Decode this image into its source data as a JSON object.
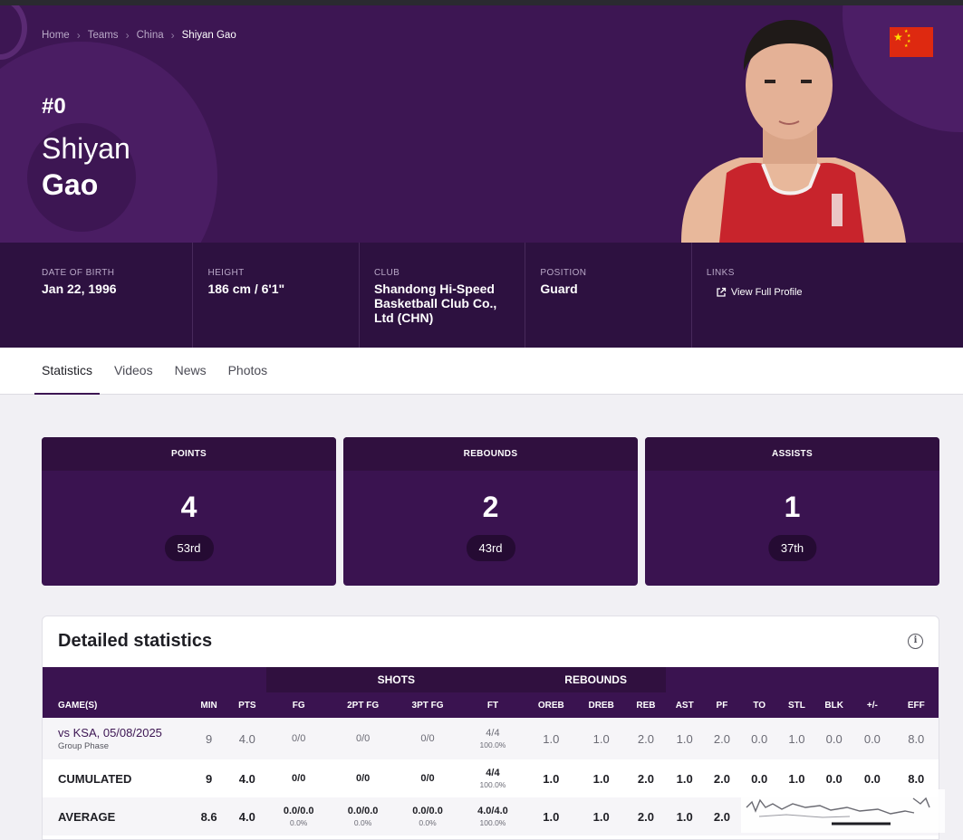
{
  "breadcrumb": [
    "Home",
    "Teams",
    "China",
    "Shiyan Gao"
  ],
  "player": {
    "jersey": "#0",
    "first_name": "Shiyan",
    "last_name": "Gao"
  },
  "info": [
    {
      "label": "DATE OF BIRTH",
      "value": "Jan 22, 1996"
    },
    {
      "label": "HEIGHT",
      "value": "186 cm / 6'1\""
    },
    {
      "label": "CLUB",
      "value": "Shandong Hi-Speed Basketball Club Co., Ltd (CHN)"
    },
    {
      "label": "POSITION",
      "value": "Guard"
    },
    {
      "label": "LINKS",
      "value": "View Full Profile"
    }
  ],
  "tabs": [
    "Statistics",
    "Videos",
    "News",
    "Photos"
  ],
  "stat_cards": [
    {
      "label": "POINTS",
      "value": "4",
      "rank": "53rd"
    },
    {
      "label": "REBOUNDS",
      "value": "2",
      "rank": "43rd"
    },
    {
      "label": "ASSISTS",
      "value": "1",
      "rank": "37th"
    }
  ],
  "detail": {
    "title": "Detailed statistics",
    "groups": {
      "shots": "SHOTS",
      "rebounds": "REBOUNDS"
    },
    "columns": [
      "GAME(S)",
      "MIN",
      "PTS",
      "FG",
      "2PT FG",
      "3PT FG",
      "FT",
      "OREB",
      "DREB",
      "REB",
      "AST",
      "PF",
      "TO",
      "STL",
      "BLK",
      "+/-",
      "EFF"
    ],
    "rows": [
      {
        "game": "vs KSA, 05/08/2025",
        "sub": "Group Phase",
        "min": "9",
        "pts": "4.0",
        "fg": "0/0",
        "fg_pct": "",
        "fg2": "0/0",
        "fg2_pct": "",
        "fg3": "0/0",
        "fg3_pct": "",
        "ft": "4/4",
        "ft_pct": "100.0%",
        "oreb": "1.0",
        "dreb": "1.0",
        "reb": "2.0",
        "ast": "1.0",
        "pf": "2.0",
        "to": "0.0",
        "stl": "1.0",
        "blk": "0.0",
        "pm": "0.0",
        "eff": "8.0"
      },
      {
        "game": "CUMULATED",
        "sub": "",
        "min": "9",
        "pts": "4.0",
        "fg": "0/0",
        "fg_pct": "",
        "fg2": "0/0",
        "fg2_pct": "",
        "fg3": "0/0",
        "fg3_pct": "",
        "ft": "4/4",
        "ft_pct": "100.0%",
        "oreb": "1.0",
        "dreb": "1.0",
        "reb": "2.0",
        "ast": "1.0",
        "pf": "2.0",
        "to": "0.0",
        "stl": "1.0",
        "blk": "0.0",
        "pm": "0.0",
        "eff": "8.0"
      },
      {
        "game": "AVERAGE",
        "sub": "",
        "min": "8.6",
        "pts": "4.0",
        "fg": "0.0/0.0",
        "fg_pct": "0.0%",
        "fg2": "0.0/0.0",
        "fg2_pct": "0.0%",
        "fg3": "0.0/0.0",
        "fg3_pct": "0.0%",
        "ft": "4.0/4.0",
        "ft_pct": "100.0%",
        "oreb": "1.0",
        "dreb": "1.0",
        "reb": "2.0",
        "ast": "1.0",
        "pf": "2.0",
        "to": "",
        "stl": "",
        "blk": "",
        "pm": "",
        "eff": ""
      }
    ]
  },
  "colors": {
    "hero_bg": "#3d1653",
    "infobar_bg": "#2d1140",
    "card_bg": "#3a1350",
    "flag_red": "#de2910",
    "flag_star": "#ffde00"
  }
}
